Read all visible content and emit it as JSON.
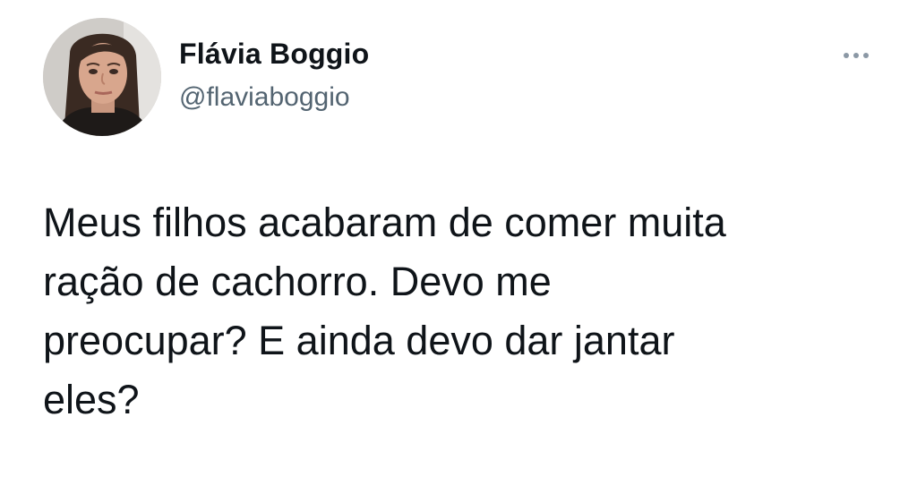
{
  "tweet": {
    "author": {
      "name": "Flávia Boggio",
      "handle": "@flaviaboggio",
      "avatar_icon": "profile-photo"
    },
    "more_icon": "more-horizontal-icon",
    "text_lines": [
      "Meus filhos acabaram de comer muita",
      "ração de cachorro. Devo me",
      "preocupar? E ainda devo dar jantar",
      "eles?"
    ]
  },
  "colors": {
    "text": "#0f1419",
    "secondary": "#536471",
    "background": "#ffffff"
  }
}
